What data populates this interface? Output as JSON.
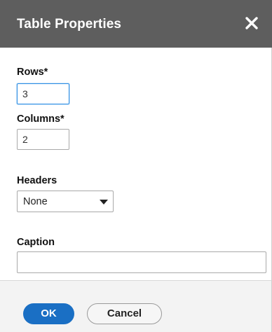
{
  "dialog": {
    "title": "Table Properties",
    "close_icon": "close-icon"
  },
  "fields": {
    "rows": {
      "label": "Rows*",
      "value": "3"
    },
    "columns": {
      "label": "Columns*",
      "value": "2"
    },
    "headers": {
      "label": "Headers",
      "selected": "None"
    },
    "caption": {
      "label": "Caption",
      "value": ""
    }
  },
  "buttons": {
    "ok": "OK",
    "cancel": "Cancel"
  },
  "colors": {
    "titlebar_bg": "#5e5e5e",
    "primary_button": "#1a6fc4",
    "focus_border": "#2f8fe4",
    "footer_bg": "#f3f3f3"
  }
}
